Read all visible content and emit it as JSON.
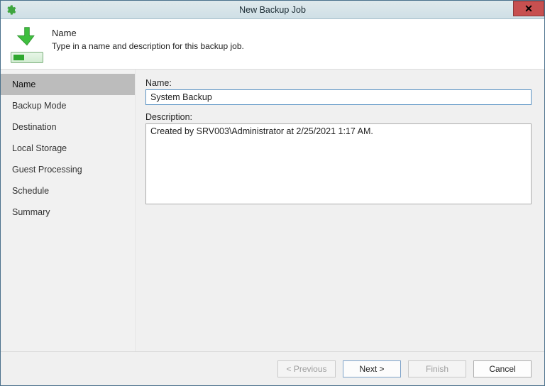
{
  "window": {
    "title": "New Backup Job"
  },
  "header": {
    "title": "Name",
    "subtitle": "Type in a name and description for this backup job."
  },
  "sidebar": {
    "items": [
      {
        "label": "Name",
        "active": true
      },
      {
        "label": "Backup Mode",
        "active": false
      },
      {
        "label": "Destination",
        "active": false
      },
      {
        "label": "Local Storage",
        "active": false
      },
      {
        "label": "Guest Processing",
        "active": false
      },
      {
        "label": "Schedule",
        "active": false
      },
      {
        "label": "Summary",
        "active": false
      }
    ]
  },
  "form": {
    "name_label": "Name:",
    "name_value": "System Backup",
    "desc_label": "Description:",
    "desc_value": "Created by SRV003\\Administrator at 2/25/2021 1:17 AM."
  },
  "buttons": {
    "previous": "< Previous",
    "next": "Next >",
    "finish": "Finish",
    "cancel": "Cancel"
  }
}
